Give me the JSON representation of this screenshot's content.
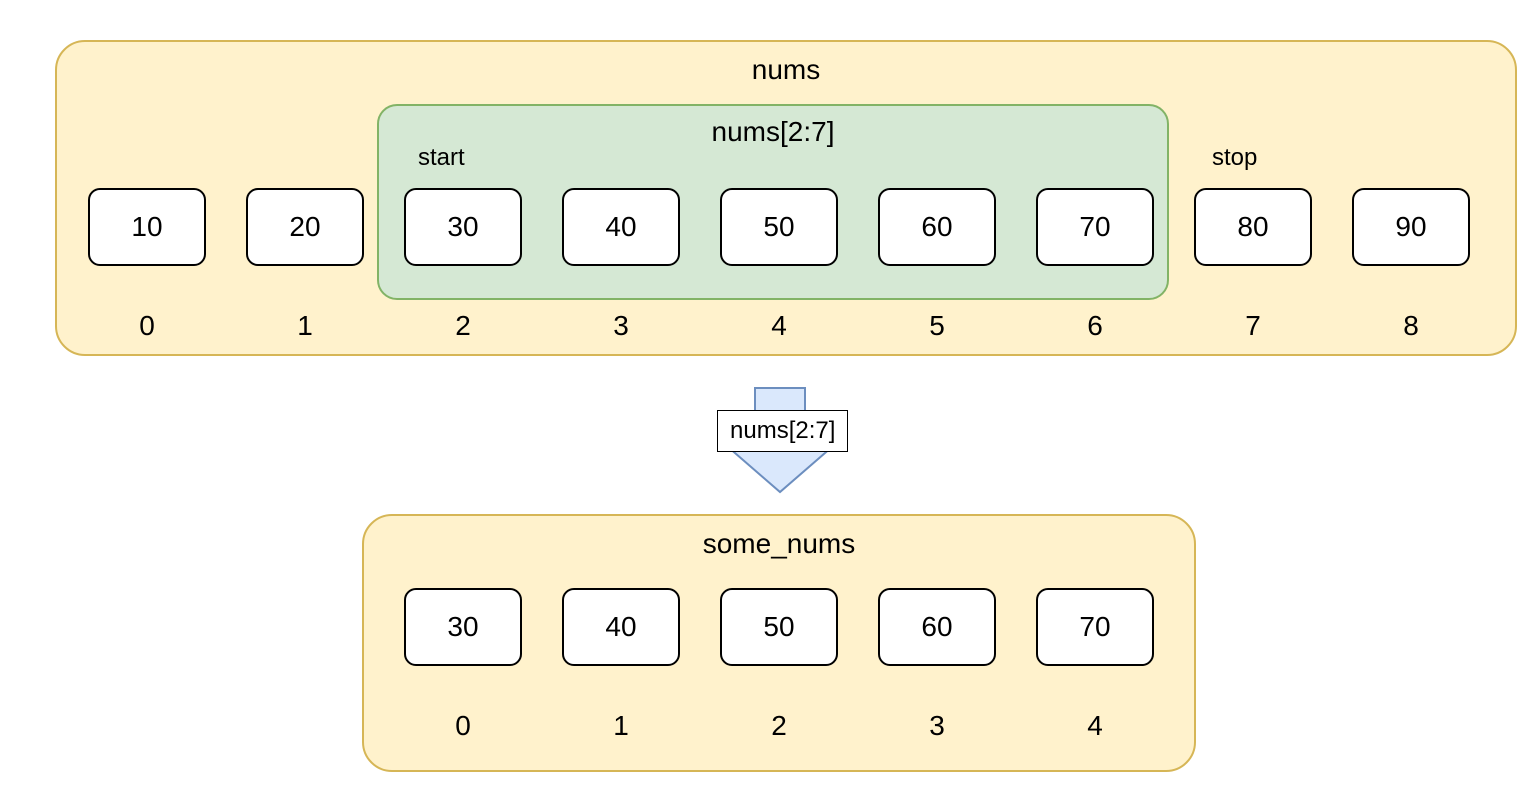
{
  "top": {
    "title": "nums",
    "slice_title": "nums[2:7]",
    "start_label": "start",
    "stop_label": "stop",
    "values": [
      "10",
      "20",
      "30",
      "40",
      "50",
      "60",
      "70",
      "80",
      "90"
    ],
    "indices": [
      "0",
      "1",
      "2",
      "3",
      "4",
      "5",
      "6",
      "7",
      "8"
    ]
  },
  "arrow": {
    "label": "nums[2:7]"
  },
  "bottom": {
    "title": "some_nums",
    "values": [
      "30",
      "40",
      "50",
      "60",
      "70"
    ],
    "indices": [
      "0",
      "1",
      "2",
      "3",
      "4"
    ]
  },
  "colors": {
    "yellow_fill": "#fff2cc",
    "yellow_stroke": "#d6b656",
    "green_fill": "#d5e8d4",
    "green_stroke": "#82b366",
    "blue_fill": "#dae8fc",
    "blue_stroke": "#6c8ebf"
  }
}
